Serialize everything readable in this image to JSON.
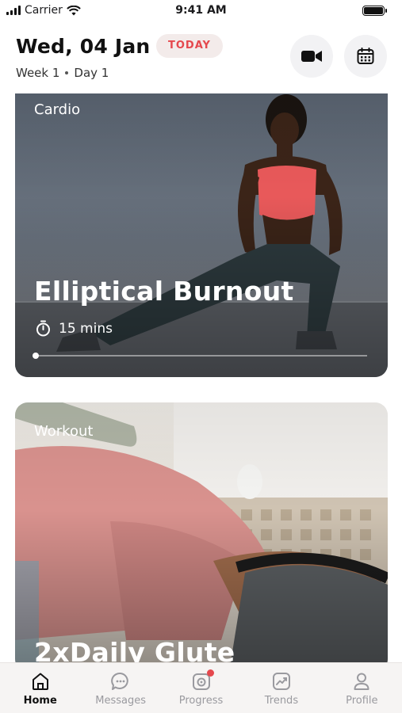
{
  "status_bar": {
    "carrier": "Carrier",
    "time": "9:41 AM"
  },
  "header": {
    "date": "Wed, 04 Jan",
    "today_badge": "TODAY",
    "week": "Week 1",
    "day": "Day 1",
    "buttons": {
      "video": "video-camera-icon",
      "calendar": "calendar-icon"
    }
  },
  "workouts": [
    {
      "category": "Cardio",
      "title": "Elliptical Burnout",
      "duration": "15 mins",
      "progress": 0.0
    },
    {
      "category": "Workout",
      "title": "2xDaily Glute"
    }
  ],
  "tabs": [
    {
      "label": "Home",
      "icon": "home-icon",
      "active": true
    },
    {
      "label": "Messages",
      "icon": "chat-icon"
    },
    {
      "label": "Progress",
      "icon": "camera-icon",
      "badge": true
    },
    {
      "label": "Trends",
      "icon": "trend-chart-icon"
    },
    {
      "label": "Profile",
      "icon": "user-icon"
    }
  ],
  "colors": {
    "accent": "#e5484d",
    "badge_bg": "#f3ebea",
    "tab_bar_bg": "#f6f4f3"
  }
}
